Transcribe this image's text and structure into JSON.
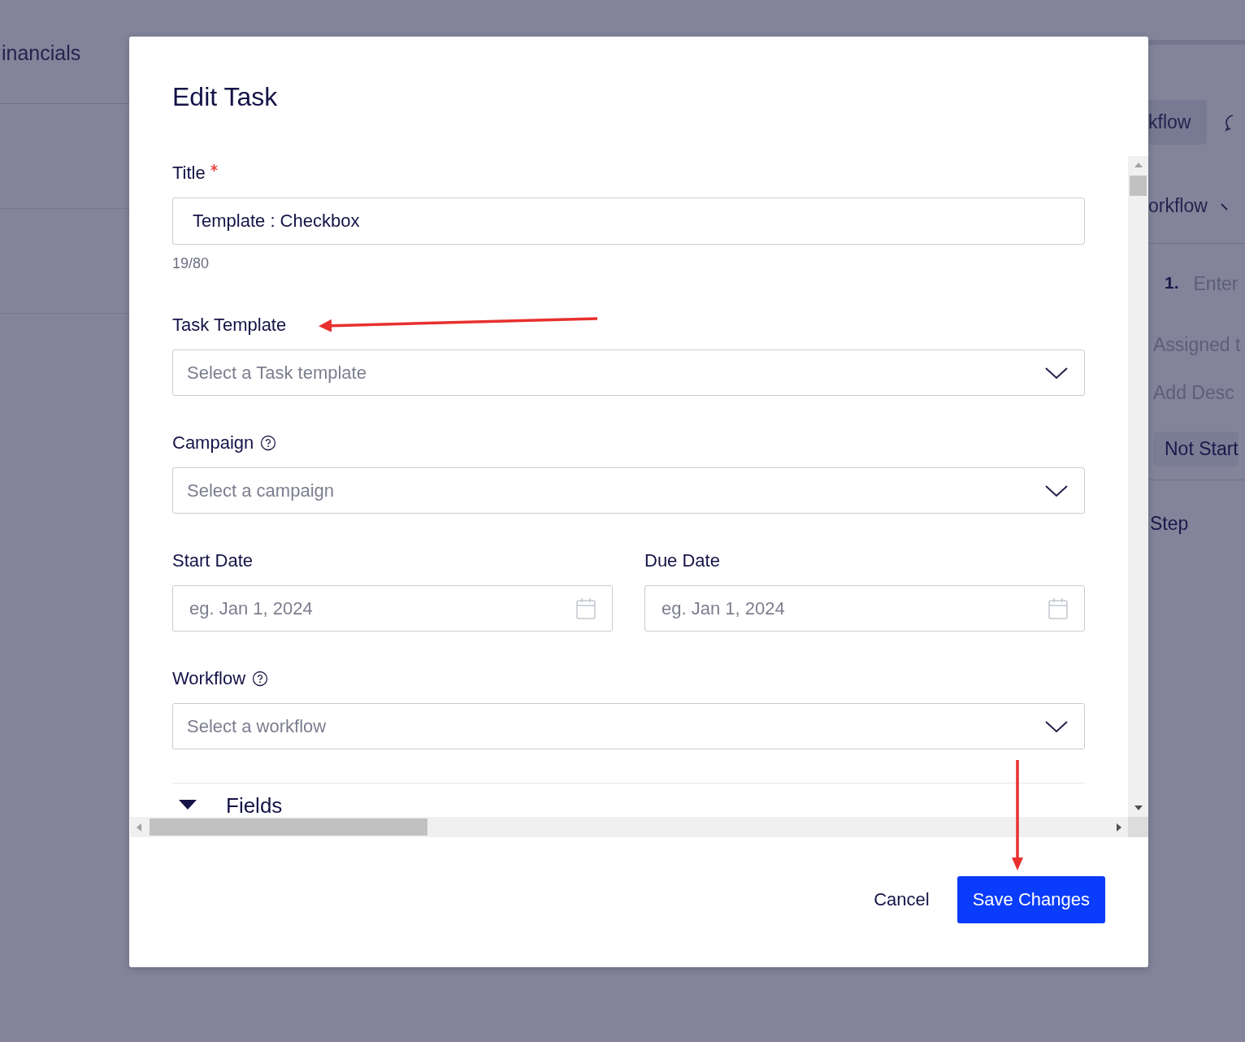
{
  "background": {
    "tab": "inancials",
    "workflow_button": "kflow",
    "workflow_menu": "orkflow",
    "step_number": "1.",
    "step_placeholder": "Enter",
    "assigned": "Assigned t",
    "description": "Add Desc",
    "status": "Not Start",
    "step_heading": "Step"
  },
  "dialog": {
    "title": "Edit Task",
    "fields": [
      {
        "kind": "text",
        "label": "Title",
        "required": true,
        "help": false,
        "value": "Template : Checkbox",
        "counter": "19/80"
      },
      {
        "kind": "select",
        "label": "Task Template",
        "required": false,
        "help": false,
        "placeholder": "Select a Task template"
      },
      {
        "kind": "select",
        "label": "Campaign",
        "required": false,
        "help": true,
        "placeholder": "Select a campaign"
      },
      {
        "kind": "dates",
        "items": [
          {
            "label": "Start Date",
            "placeholder": "eg. Jan 1, 2024"
          },
          {
            "label": "Due Date",
            "placeholder": "eg. Jan 1, 2024"
          }
        ]
      },
      {
        "kind": "select",
        "label": "Workflow",
        "required": false,
        "help": true,
        "placeholder": "Select a workflow"
      }
    ],
    "section": {
      "label": "Fields",
      "expanded": true
    },
    "buttons": [
      {
        "label": "Cancel",
        "kind": "secondary"
      },
      {
        "label": "Save Changes",
        "kind": "primary"
      }
    ]
  }
}
